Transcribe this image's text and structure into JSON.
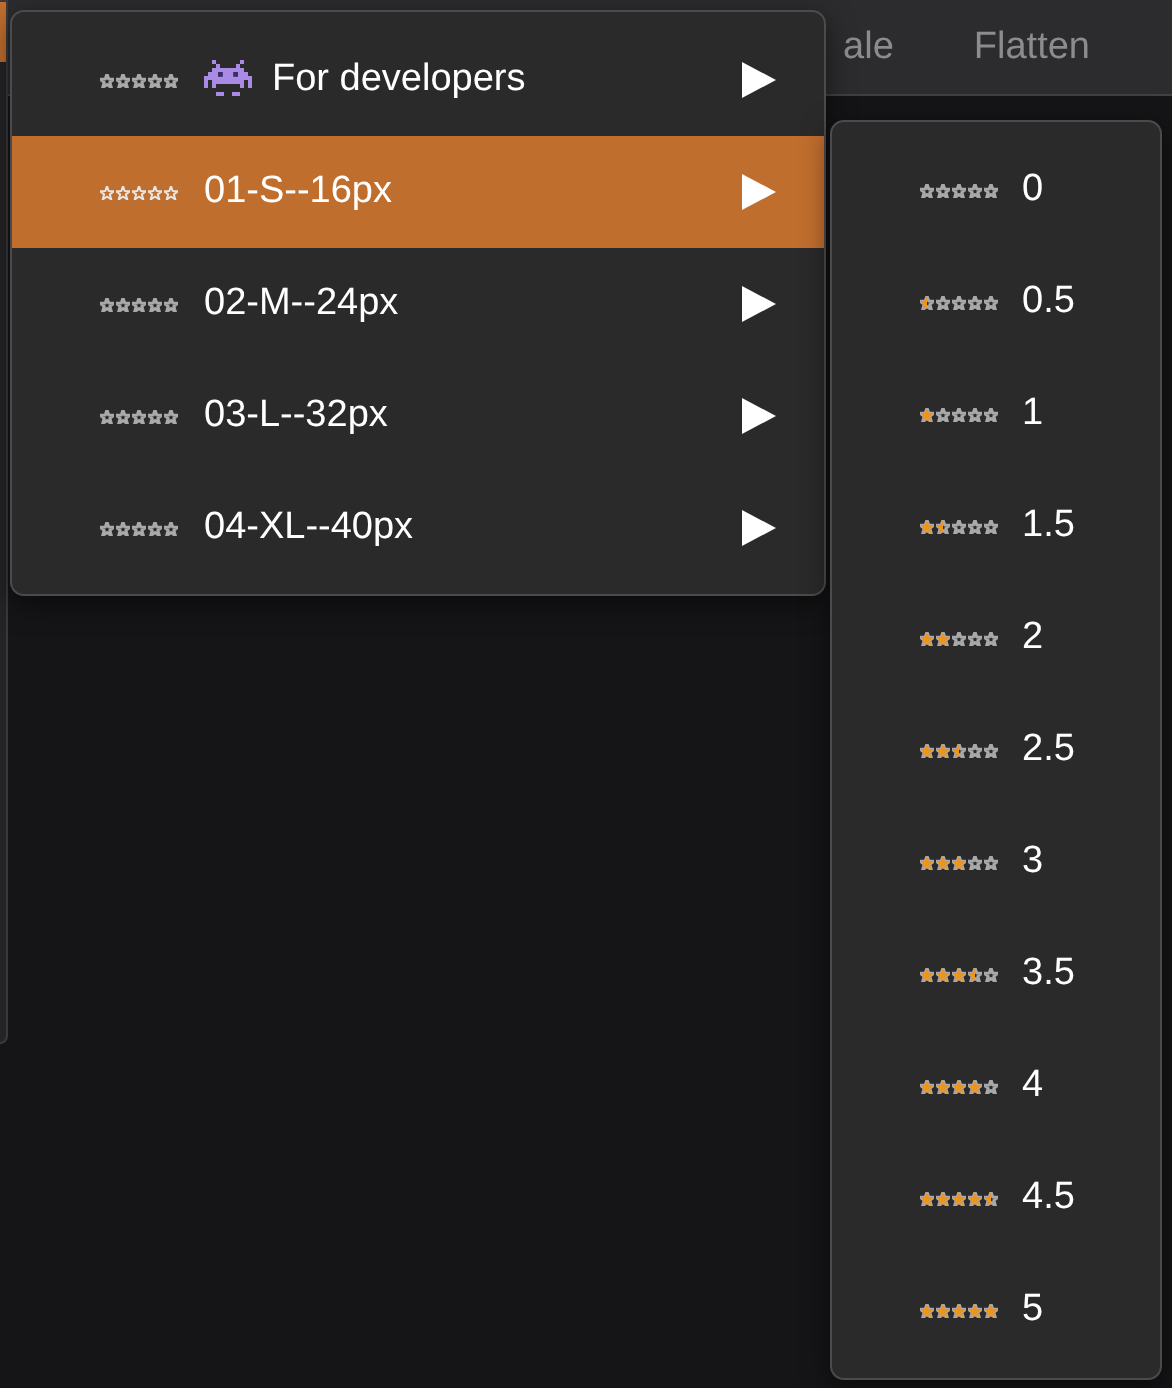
{
  "toolbar": {
    "items": [
      "ale",
      "Flatten"
    ]
  },
  "menu": {
    "items": [
      {
        "kind": "icon",
        "label": "For developers",
        "stars": 0,
        "selected": false
      },
      {
        "kind": "plain",
        "label": "01-S--16px",
        "stars": 0,
        "selected": true
      },
      {
        "kind": "plain",
        "label": "02-M--24px",
        "stars": 0,
        "selected": false
      },
      {
        "kind": "plain",
        "label": "03-L--32px",
        "stars": 0,
        "selected": false
      },
      {
        "kind": "plain",
        "label": "04-XL--40px",
        "stars": 0,
        "selected": false
      }
    ]
  },
  "submenu": {
    "items": [
      {
        "label": "0",
        "stars": 0,
        "selected": false
      },
      {
        "label": "0.5",
        "stars": 0.5,
        "selected": false
      },
      {
        "label": "1",
        "stars": 1,
        "selected": false
      },
      {
        "label": "1.5",
        "stars": 1.5,
        "selected": false
      },
      {
        "label": "2",
        "stars": 2,
        "selected": false
      },
      {
        "label": "2.5",
        "stars": 2.5,
        "selected": false
      },
      {
        "label": "3",
        "stars": 3,
        "selected": false
      },
      {
        "label": "3.5",
        "stars": 3.5,
        "selected": false
      },
      {
        "label": "4",
        "stars": 4,
        "selected": false
      },
      {
        "label": "4.5",
        "stars": 4.5,
        "selected": false
      },
      {
        "label": "5",
        "stars": 5,
        "selected": false
      }
    ]
  }
}
